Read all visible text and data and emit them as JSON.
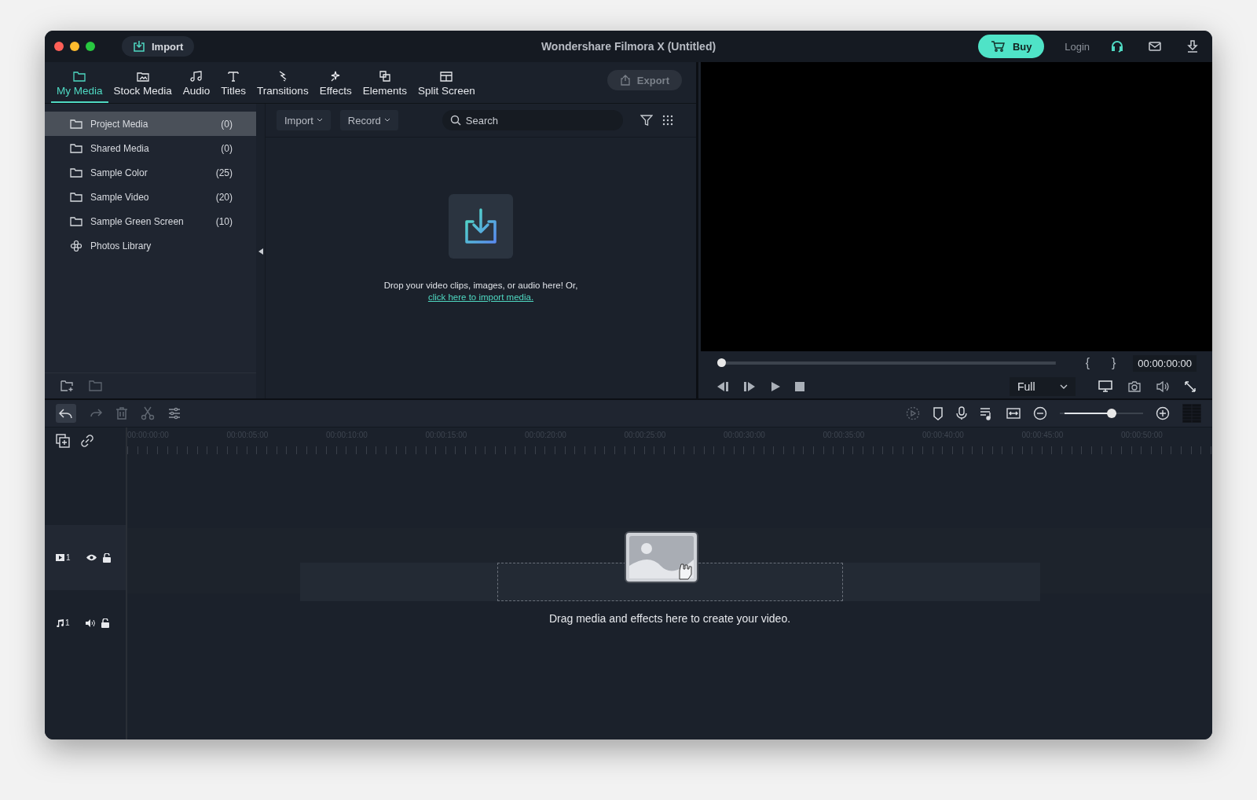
{
  "window": {
    "title": "Wondershare Filmora X (Untitled)"
  },
  "titlebar": {
    "import_button": "Import",
    "buy_button": "Buy",
    "login": "Login"
  },
  "tabs": [
    {
      "label": "My Media",
      "selected": true
    },
    {
      "label": "Stock Media",
      "selected": false
    },
    {
      "label": "Audio",
      "selected": false
    },
    {
      "label": "Titles",
      "selected": false
    },
    {
      "label": "Transitions",
      "selected": false
    },
    {
      "label": "Effects",
      "selected": false
    },
    {
      "label": "Elements",
      "selected": false
    },
    {
      "label": "Split Screen",
      "selected": false
    }
  ],
  "export_button": {
    "label": "Export",
    "disabled": true
  },
  "media_sidebar": {
    "items": [
      {
        "label": "Project Media",
        "count": "(0)",
        "kind": "folder",
        "selected": true
      },
      {
        "label": "Shared Media",
        "count": "(0)",
        "kind": "folder",
        "selected": false
      },
      {
        "label": "Sample Color",
        "count": "(25)",
        "kind": "folder",
        "selected": false
      },
      {
        "label": "Sample Video",
        "count": "(20)",
        "kind": "folder",
        "selected": false
      },
      {
        "label": "Sample Green Screen",
        "count": "(10)",
        "kind": "folder",
        "selected": false
      },
      {
        "label": "Photos Library",
        "kind": "photos",
        "selected": false
      }
    ]
  },
  "media_toolbar": {
    "import_dropdown": "Import",
    "record_dropdown": "Record",
    "search": {
      "placeholder": "Search"
    }
  },
  "drop_zone": {
    "text": "Drop your video clips, images, or audio here! Or,",
    "link": "click here to import media."
  },
  "preview": {
    "scrubber": {
      "level": 0
    },
    "mark_in": "{",
    "mark_out": "}",
    "timecode": "00:00:00:00",
    "quality": "Full"
  },
  "timeline": {
    "zoom": {
      "level": 0.62
    },
    "ruler": [
      "00:00:00:00",
      "00:00:05:00",
      "00:00:10:00",
      "00:00:15:00",
      "00:00:20:00",
      "00:00:25:00",
      "00:00:30:00",
      "00:00:35:00",
      "00:00:40:00",
      "00:00:45:00",
      "00:00:50:00"
    ],
    "tracks": [
      {
        "kind": "video",
        "number": "1"
      },
      {
        "kind": "audio",
        "number": "1"
      }
    ],
    "hint": "Drag media and effects here to create your video."
  }
}
